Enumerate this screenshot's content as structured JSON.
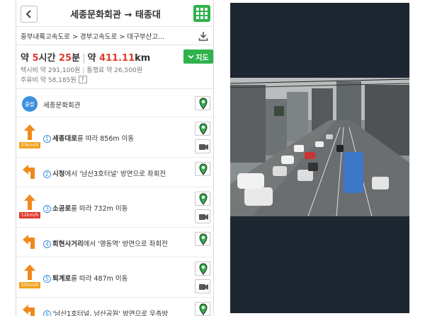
{
  "header": {
    "back_label": "<",
    "route_title": "세종문화회관 → 태종대"
  },
  "roads": "중부내륙고속도로 > 경부고속도로 > 대구부산고...",
  "summary": {
    "prefix": "약",
    "hours": "5",
    "hours_unit": "시간",
    "minutes": "25",
    "minutes_unit": "분",
    "distance_prefix": "약",
    "distance": "411.11",
    "distance_unit": "km",
    "map_button": "지도",
    "taxi": "택시비 약 291,100원",
    "toll": "통행료 약 26,500원",
    "fuel": "주유비 약 58,185원",
    "help": "?"
  },
  "steps": [
    {
      "type": "start",
      "badge": "출발",
      "text": "세종문화회관"
    },
    {
      "num": "1",
      "bold": "세종대로",
      "rest": "를 따라 856m 이동",
      "arrow": "straight",
      "speed": "23km/h",
      "speed_color": "#f0a11b"
    },
    {
      "num": "2",
      "bold": "시청",
      "rest": "에서 '남산3호터널' 방면으로 좌회전",
      "arrow": "left"
    },
    {
      "num": "3",
      "bold": "소공로",
      "rest": "를 따라 732m 이동",
      "arrow": "straight",
      "speed": "12km/h",
      "speed_color": "#e03b2b"
    },
    {
      "num": "4",
      "bold": "회현사거리",
      "rest": "에서 '명동역' 방면으로 좌회전",
      "arrow": "left"
    },
    {
      "num": "5",
      "bold": "퇴계로",
      "rest": "를 따라 487m 이동",
      "arrow": "straight",
      "speed": "25km/h",
      "speed_color": "#f0a11b"
    },
    {
      "num": "6",
      "bold": "",
      "rest": "'남산1호터널, 남산공원' 방면으로 우측방",
      "arrow": "left"
    }
  ],
  "colors": {
    "accent_green": "#2fb24c",
    "highlight_red": "#e03b2b",
    "arrow_orange": "#f08a1c",
    "start_blue": "#3a8fe0",
    "dark_panel": "#1d2731"
  },
  "icons": {
    "back": "chevron-left-icon",
    "menu": "grid-icon",
    "download": "download-icon",
    "pin": "map-pin-icon",
    "camera": "video-camera-icon"
  }
}
